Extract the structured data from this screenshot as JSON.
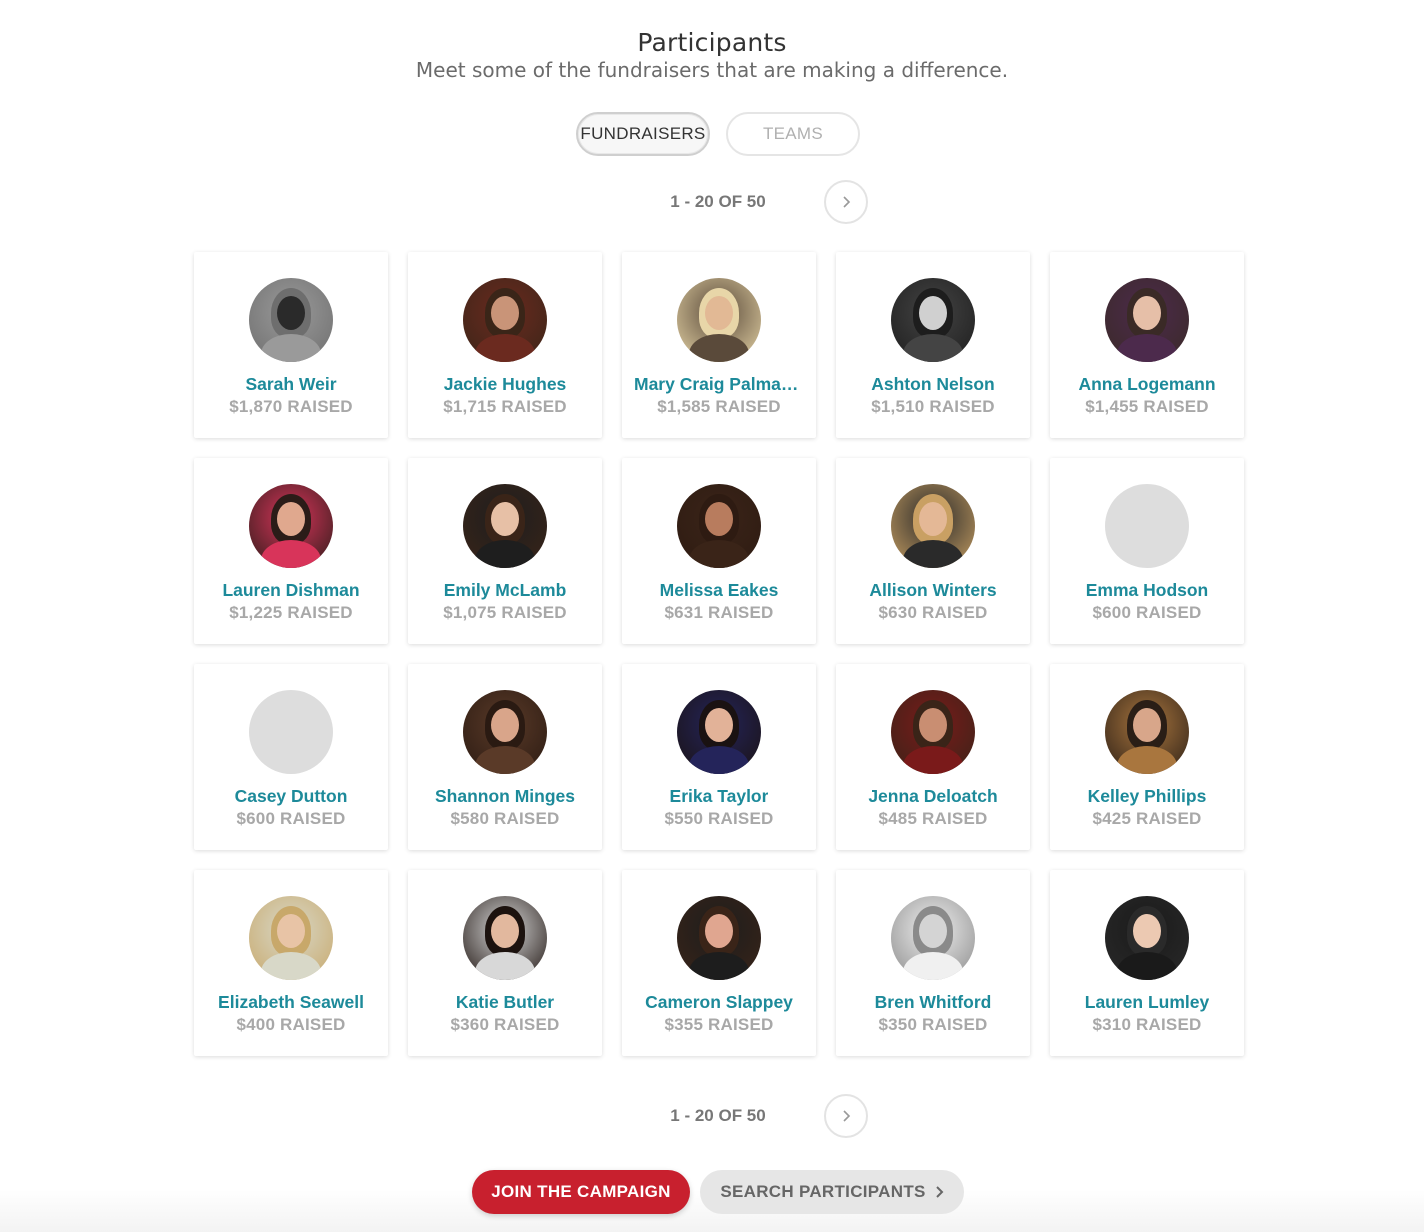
{
  "header": {
    "title": "Participants",
    "subtitle": "Meet some of the fundraisers that are making a difference."
  },
  "tabs": [
    {
      "label": "FUNDRAISERS",
      "active": true
    },
    {
      "label": "TEAMS",
      "active": false
    }
  ],
  "pager": {
    "range_text": "1 - 20 OF 50",
    "next_icon": "chevron-right-icon"
  },
  "participants": [
    {
      "name": "Sarah Weir",
      "raised": "$1,870 RAISED",
      "avatar": "photo"
    },
    {
      "name": "Jackie Hughes",
      "raised": "$1,715 RAISED",
      "avatar": "photo"
    },
    {
      "name": "Mary Craig Palmat…",
      "raised": "$1,585 RAISED",
      "avatar": "photo"
    },
    {
      "name": "Ashton Nelson",
      "raised": "$1,510 RAISED",
      "avatar": "photo"
    },
    {
      "name": "Anna Logemann",
      "raised": "$1,455 RAISED",
      "avatar": "photo"
    },
    {
      "name": "Lauren Dishman",
      "raised": "$1,225 RAISED",
      "avatar": "photo"
    },
    {
      "name": "Emily McLamb",
      "raised": "$1,075 RAISED",
      "avatar": "photo"
    },
    {
      "name": "Melissa Eakes",
      "raised": "$631 RAISED",
      "avatar": "photo"
    },
    {
      "name": "Allison Winters",
      "raised": "$630 RAISED",
      "avatar": "photo"
    },
    {
      "name": "Emma Hodson",
      "raised": "$600 RAISED",
      "avatar": "placeholder"
    },
    {
      "name": "Casey Dutton",
      "raised": "$600 RAISED",
      "avatar": "placeholder"
    },
    {
      "name": "Shannon Minges",
      "raised": "$580 RAISED",
      "avatar": "photo"
    },
    {
      "name": "Erika Taylor",
      "raised": "$550 RAISED",
      "avatar": "photo"
    },
    {
      "name": "Jenna Deloatch",
      "raised": "$485 RAISED",
      "avatar": "photo"
    },
    {
      "name": "Kelley Phillips",
      "raised": "$425 RAISED",
      "avatar": "photo"
    },
    {
      "name": "Elizabeth Seawell",
      "raised": "$400 RAISED",
      "avatar": "photo"
    },
    {
      "name": "Katie Butler",
      "raised": "$360 RAISED",
      "avatar": "photo"
    },
    {
      "name": "Cameron Slappey",
      "raised": "$355 RAISED",
      "avatar": "photo"
    },
    {
      "name": "Bren Whitford",
      "raised": "$350 RAISED",
      "avatar": "photo"
    },
    {
      "name": "Lauren Lumley",
      "raised": "$310 RAISED",
      "avatar": "photo"
    }
  ],
  "actions": {
    "join_label": "JOIN THE CAMPAIGN",
    "search_label": "SEARCH PARTICIPANTS",
    "search_icon": "chevron-right-icon"
  },
  "colors": {
    "name": "#1d8a9a",
    "raised": "#a8a8a8",
    "join_button": "#c8202e",
    "search_button": "#e6e6e6"
  }
}
